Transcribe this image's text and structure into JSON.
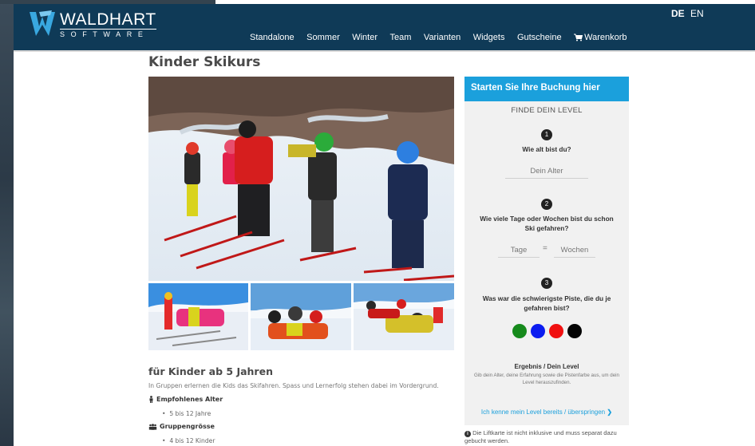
{
  "logo": {
    "name": "WALDHART",
    "sub": "SOFTWARE"
  },
  "nav": {
    "items": [
      "Standalone",
      "Sommer",
      "Winter",
      "Team",
      "Varianten",
      "Widgets",
      "Gutscheine"
    ],
    "cart_label": "Warenkorb"
  },
  "lang": {
    "active": "DE",
    "other": "EN"
  },
  "page": {
    "title": "Kinder Skikurs",
    "section_title": "für Kinder ab 5 Jahren",
    "description": "In Gruppen erlernen die Kids das Skifahren. Spass und Lernerfolg stehen dabei im Vordergrund.",
    "features": [
      {
        "label": "Empfohlenes Alter",
        "value": "5 bis 12 Jahre",
        "icon": "child-icon"
      },
      {
        "label": "Gruppengrösse",
        "value": "4 bis 12 Kinder",
        "icon": "group-icon"
      }
    ]
  },
  "booking": {
    "header": "Starten Sie Ihre Buchung hier",
    "level_title": "FINDE DEIN LEVEL",
    "step1": {
      "num": "1",
      "question": "Wie alt bist du?",
      "placeholder": "Dein Alter"
    },
    "step2": {
      "num": "2",
      "question": "Wie viele Tage oder Wochen bist du schon Ski gefahren?",
      "days_placeholder": "Tage",
      "equals": "=",
      "weeks_placeholder": "Wochen"
    },
    "step3": {
      "num": "3",
      "question": "Was war die schwierigste Piste, die du je gefahren bist?",
      "colors": [
        "#168a1c",
        "#0b1cf0",
        "#f01010",
        "#050505"
      ]
    },
    "result_title": "Ergebnis / Dein Level",
    "result_desc": "Gib dein Alter, deine Erfahrung sowie die Pistenfarbe aus, um dein Level herauszufinden.",
    "skip_label": "Ich kenne mein Level bereits / überspringen",
    "note": "Die Liftkarte ist nicht inklusive und muss separat dazu gebucht werden."
  }
}
